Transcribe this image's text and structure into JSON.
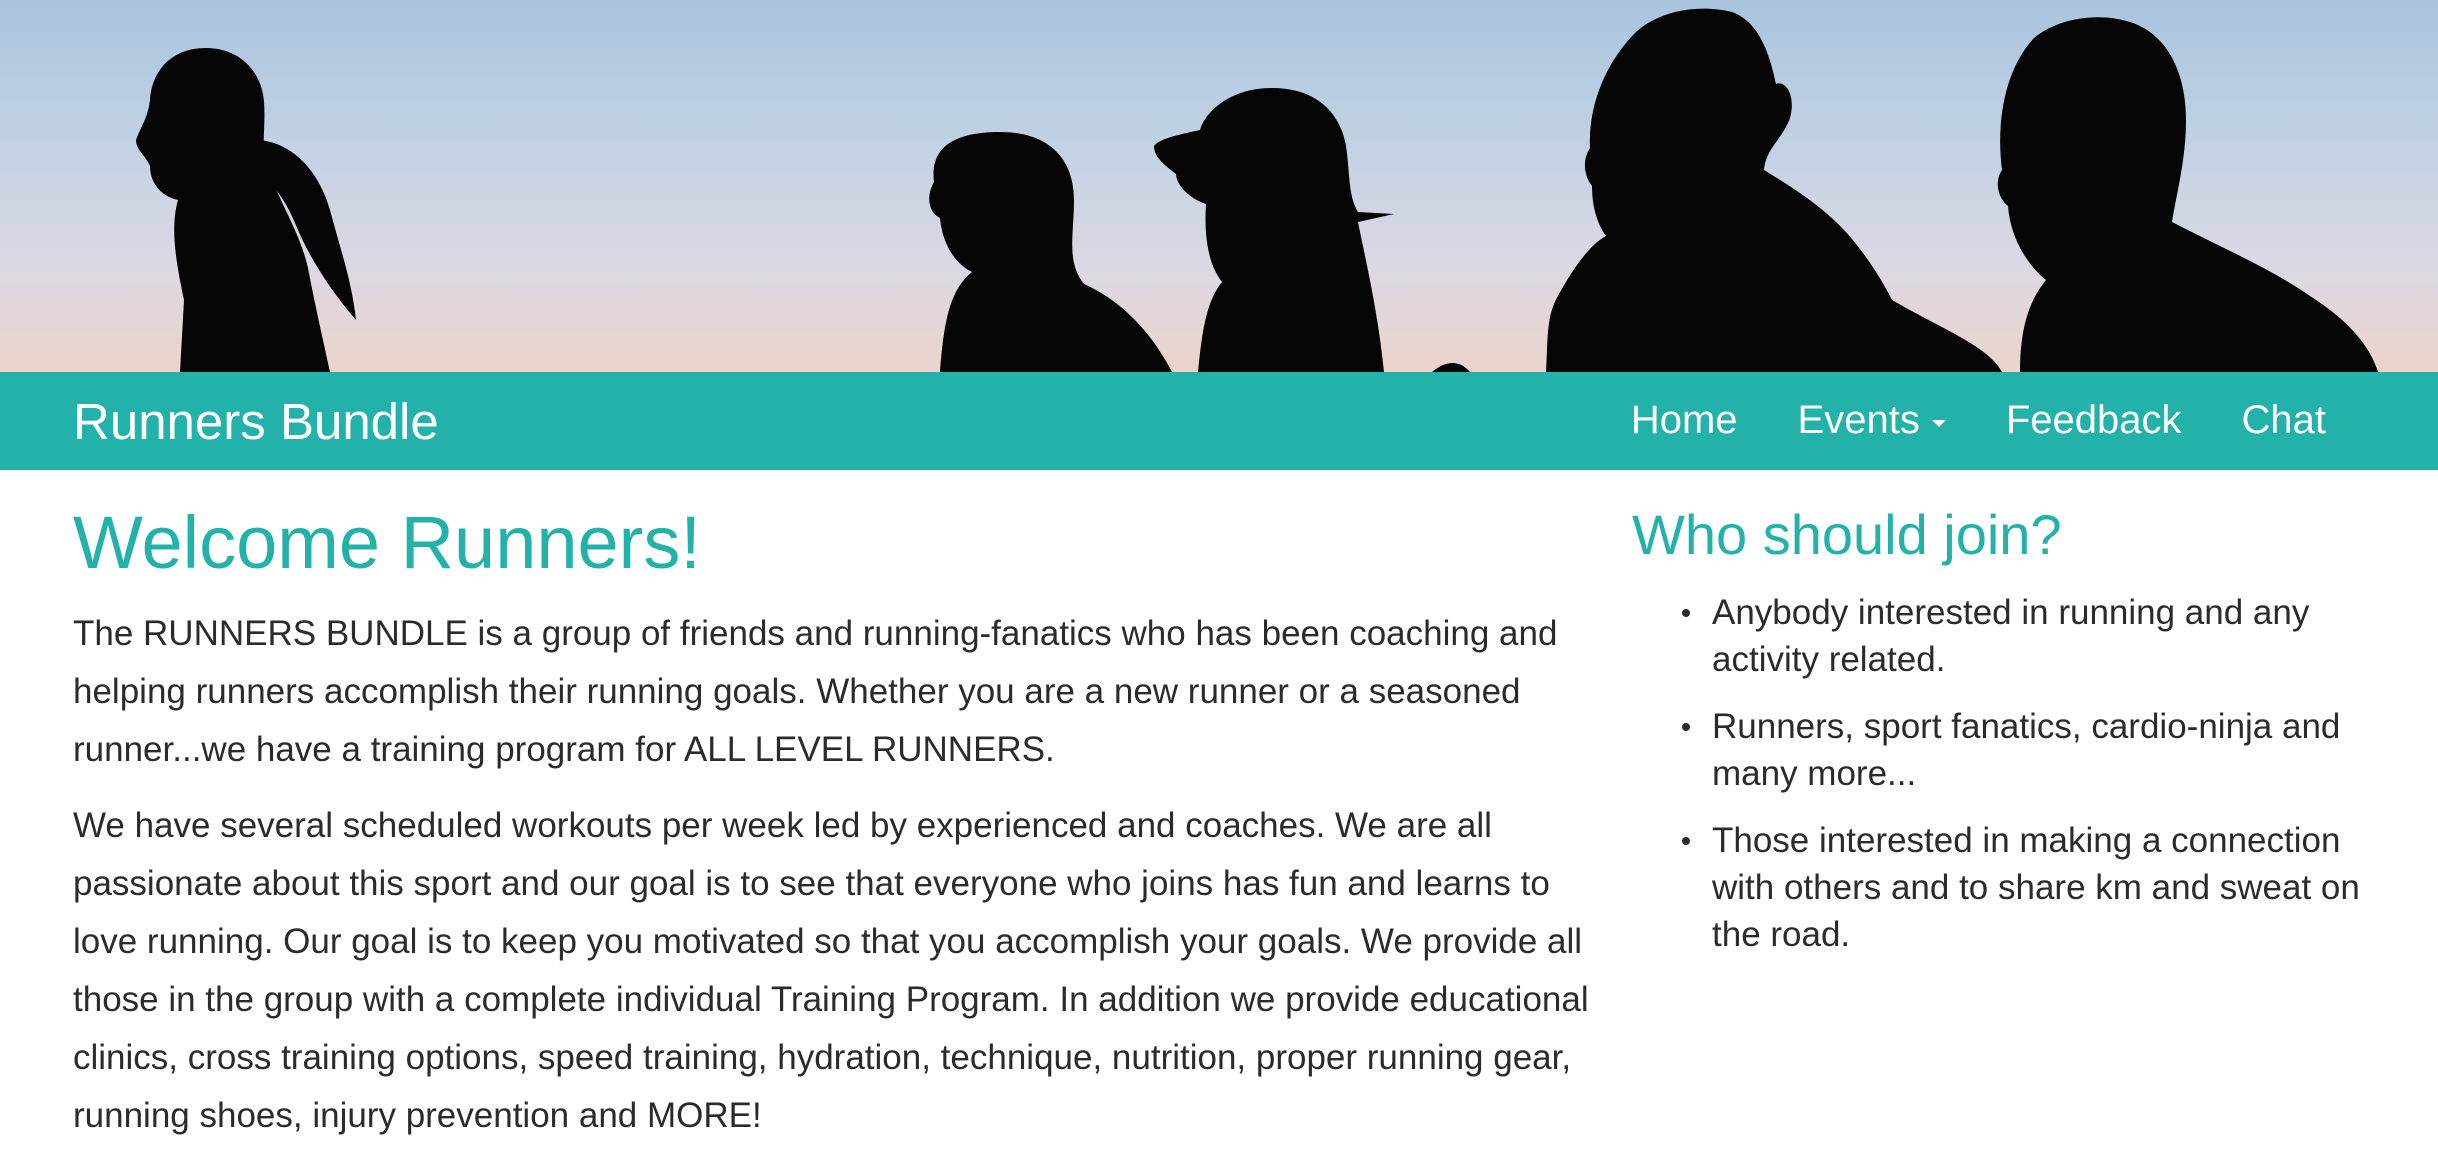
{
  "hero": {
    "image_description_icon": "runners-silhouette-banner"
  },
  "navbar": {
    "brand": "Runners Bundle",
    "links": [
      {
        "label": "Home"
      },
      {
        "label": "Events",
        "has_dropdown": true
      },
      {
        "label": "Feedback"
      },
      {
        "label": "Chat"
      }
    ]
  },
  "main": {
    "title": "Welcome Runners!",
    "paragraphs": [
      "The RUNNERS BUNDLE is a group of friends and running-fanatics who has been coaching and helping runners accomplish their running goals. Whether you are a new runner or a seasoned runner...we have a training program for ALL LEVEL RUNNERS.",
      "We have several scheduled workouts per week led by experienced and coaches. We are all passionate about this sport and our goal is to see that everyone who joins has fun and learns to love running. Our goal is to keep you motivated so that you accomplish your goals. We provide all those in the group with a complete individual Training Program. In addition we provide educational clinics, cross training options, speed training, hydration, technique, nutrition, proper running gear, running shoes, injury prevention and MORE!"
    ]
  },
  "sidebar": {
    "title": "Who should join?",
    "items": [
      "Anybody interested in running and any activity related.",
      "Runners, sport fanatics, cardio-ninja and many more...",
      "Those interested in making a connection with others and to share km and sweat on the road."
    ]
  },
  "colors": {
    "accent": "#22b2aa",
    "text": "#2b2b2b",
    "nav_text": "#ffffff",
    "silhouette": "#050505"
  }
}
